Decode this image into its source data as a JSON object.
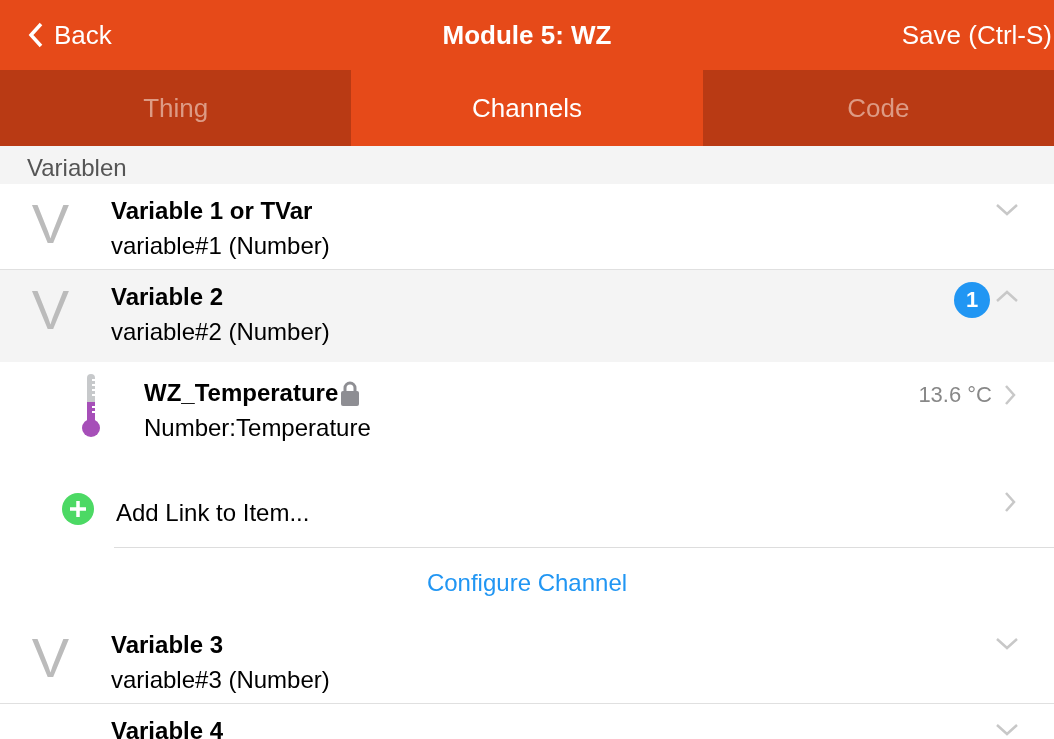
{
  "header": {
    "back": "Back",
    "title": "Module 5: WZ",
    "save": "Save (Ctrl-S)"
  },
  "tabs": [
    {
      "label": "Thing",
      "selected": false
    },
    {
      "label": "Channels",
      "selected": true
    },
    {
      "label": "Code",
      "selected": false
    }
  ],
  "section": "Variablen",
  "channels": [
    {
      "avatar": "V",
      "title": "Variable 1 or TVar",
      "subtitle": "variable#1 (Number)",
      "expanded": false
    },
    {
      "avatar": "V",
      "title": "Variable 2",
      "subtitle": "variable#2 (Number)",
      "expanded": true,
      "badge": "1",
      "links": [
        {
          "name": "WZ_Temperature",
          "type": "Number:Temperature",
          "value": "13.6 °C",
          "locked": true
        }
      ],
      "add_link": "Add Link to Item...",
      "configure": "Configure Channel"
    },
    {
      "avatar": "V",
      "title": "Variable 3",
      "subtitle": "variable#3 (Number)",
      "expanded": false
    },
    {
      "title": "Variable 4",
      "expanded": false
    }
  ]
}
